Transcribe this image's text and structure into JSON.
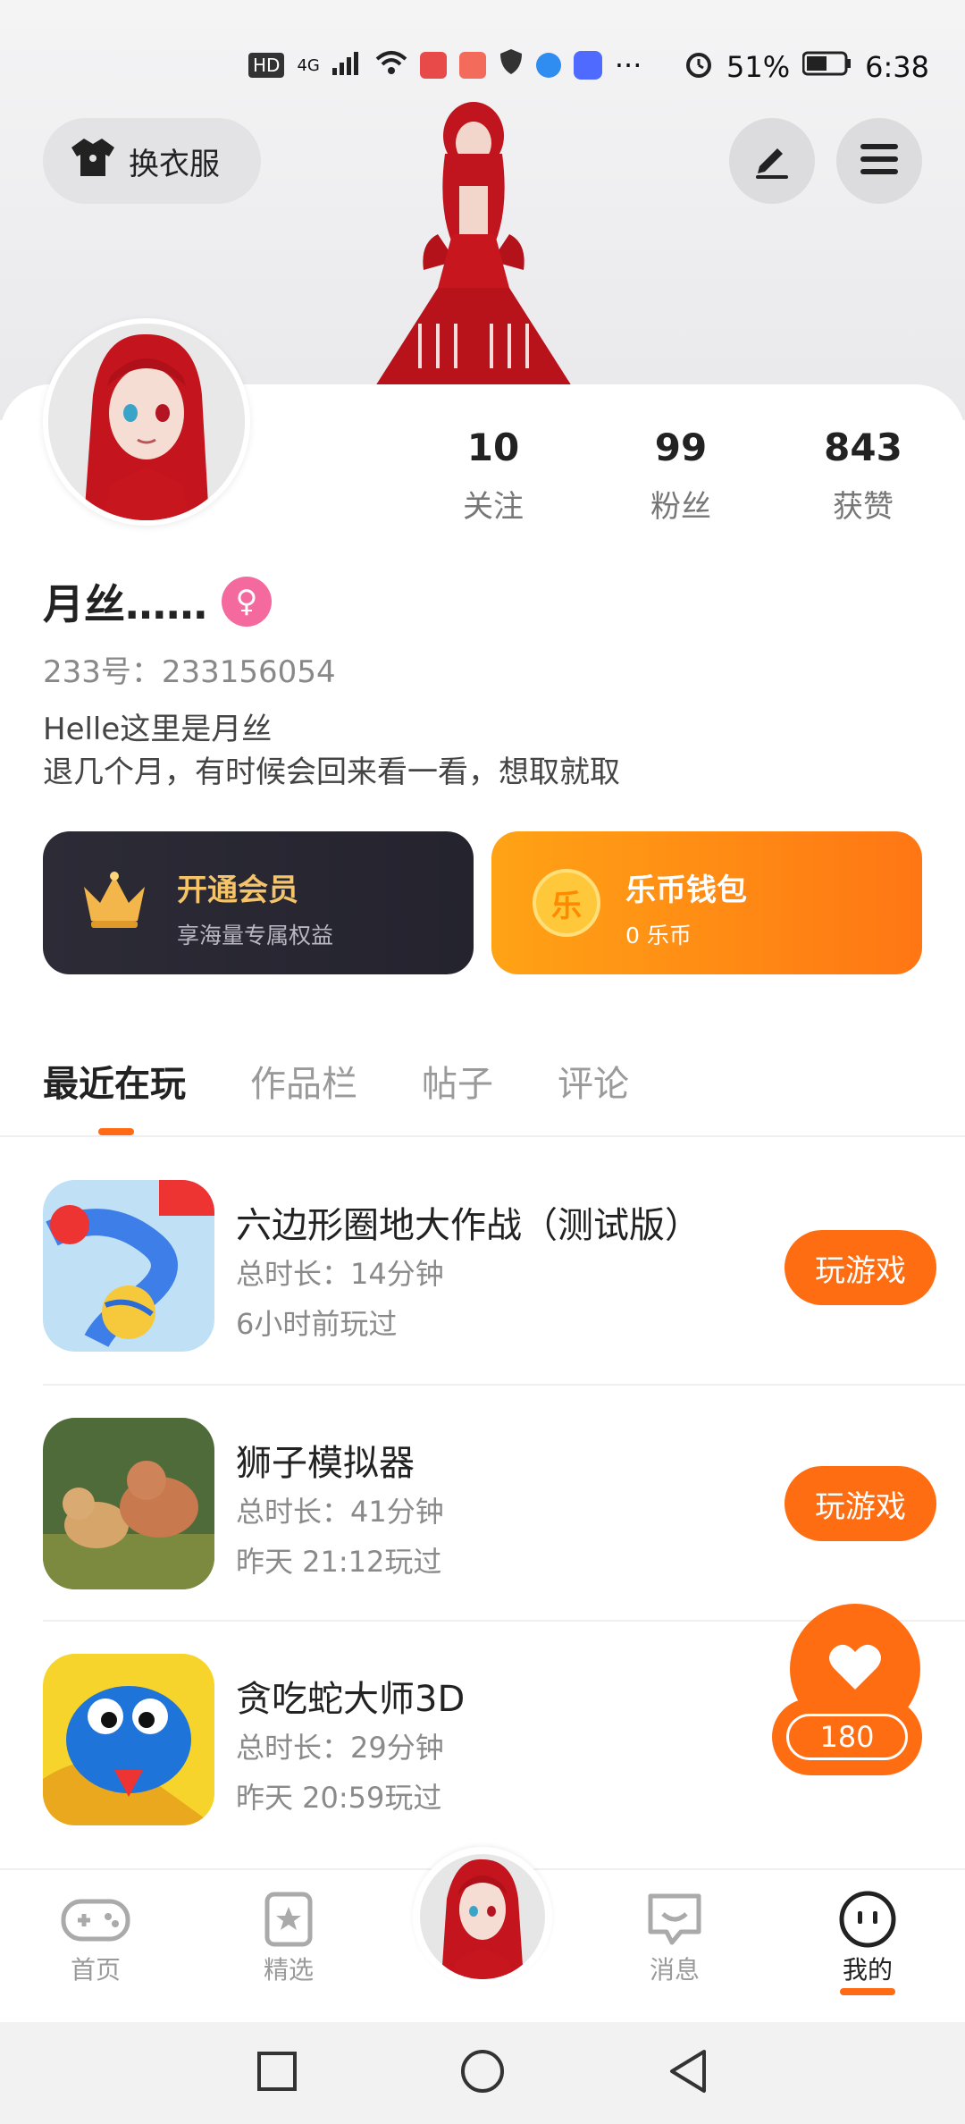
{
  "status_bar": {
    "network": "HD",
    "signal_type": "4G",
    "more": "···",
    "battery_percent": "51%",
    "time": "6:38"
  },
  "header": {
    "outfit_button_label": "换衣服",
    "edit_icon": "pen-icon",
    "menu_icon": "hamburger-icon"
  },
  "stats": {
    "following_count": "10",
    "following_label": "关注",
    "followers_count": "99",
    "followers_label": "粉丝",
    "likes_count": "843",
    "likes_label": "获赞"
  },
  "profile": {
    "name": "月丝……",
    "gender_symbol": "♀",
    "id_label": "233号：233156054",
    "bio_line1": "Helle这里是月丝",
    "bio_line2": "退几个月，有时候会回来看一看，想取就取"
  },
  "vip": {
    "title": "开通会员",
    "subtitle": "享海量专属权益"
  },
  "wallet": {
    "coin_glyph": "乐",
    "title": "乐币钱包",
    "subtitle": "0 乐币"
  },
  "tabs": [
    "最近在玩",
    "作品栏",
    "帖子",
    "评论"
  ],
  "games": [
    {
      "title": "六边形圈地大作战（测试版）",
      "duration": "总时长：14分钟",
      "last_played": "6小时前玩过",
      "button": "玩游戏"
    },
    {
      "title": "狮子模拟器",
      "duration": "总时长：41分钟",
      "last_played": "昨天 21:12玩过",
      "button": "玩游戏"
    },
    {
      "title": "贪吃蛇大师3D",
      "duration": "总时长：29分钟",
      "last_played": "昨天 20:59玩过"
    }
  ],
  "like_fab": {
    "count": "180"
  },
  "bottom_nav": {
    "home": "首页",
    "featured": "精选",
    "messages": "消息",
    "mine": "我的"
  },
  "colors": {
    "accent": "#ff6d12",
    "vip_bg": "#2c2b36",
    "gender_pink": "#f46a9e"
  }
}
